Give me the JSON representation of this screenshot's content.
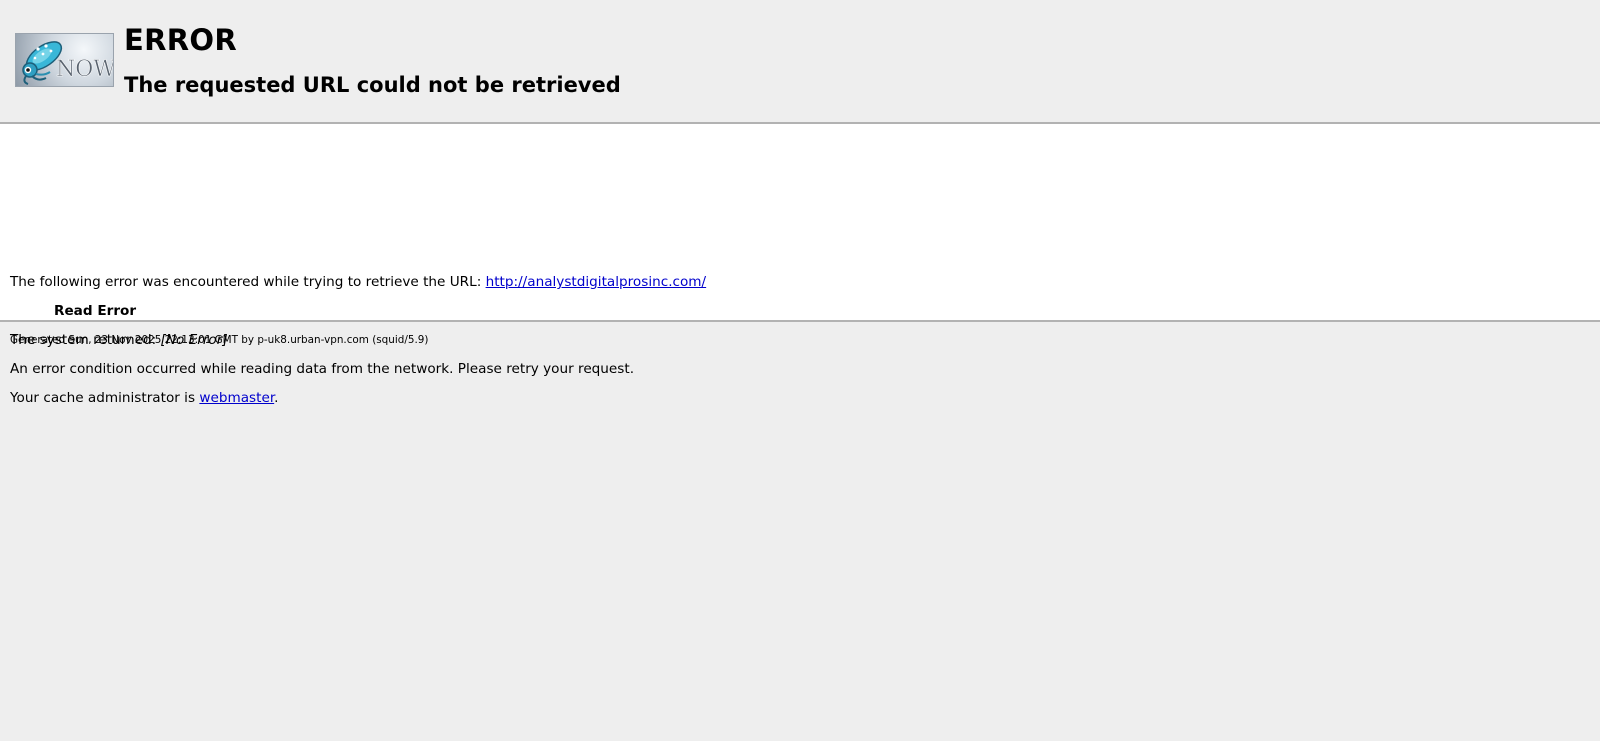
{
  "header": {
    "title": "ERROR",
    "subtitle": "The requested URL could not be retrieved",
    "logo_icon": "squid-now-logo",
    "logo_text": "NOW"
  },
  "content": {
    "url_intro": "The following error was encountered while trying to retrieve the URL: ",
    "url_link": "http://analystdigitalprosinc.com/",
    "error_name": "Read Error",
    "system_returned_label": "The system returned: ",
    "system_returned_value": "[No Error]",
    "description": "An error condition occurred while reading data from the network. Please retry your request.",
    "admin_prefix": "Your cache administrator is ",
    "admin_link": "webmaster",
    "admin_suffix": "."
  },
  "footer": {
    "generated": "Generated Sun, 23 Nov 2025 22:13:01 GMT by p-uk8.urban-vpn.com (squid/5.9)"
  },
  "colors": {
    "background": "#eeeeee",
    "content_background": "#ffffff",
    "link": "#0000cc",
    "divider": "#b2b2b2"
  }
}
